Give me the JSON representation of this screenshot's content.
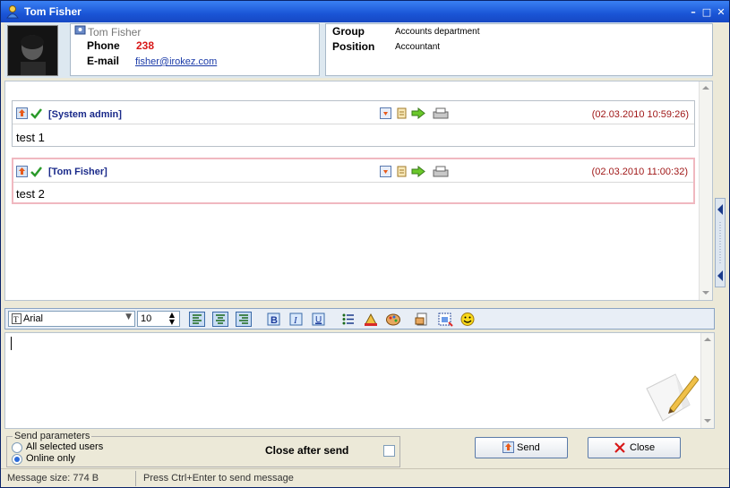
{
  "window": {
    "title": "Tom Fisher"
  },
  "contact": {
    "name": "Tom Fisher",
    "phone_label": "Phone",
    "phone": "238",
    "email_label": "E-mail",
    "email": "fisher@irokez.com",
    "group_label": "Group",
    "group": "Accounts department",
    "position_label": "Position",
    "position": "Accountant"
  },
  "messages": [
    {
      "sender": "[System admin]",
      "time": "(02.03.2010 10:59:26)",
      "text": "test 1"
    },
    {
      "sender": "[Tom Fisher]",
      "time": "(02.03.2010 11:00:32)",
      "text": "test 2"
    }
  ],
  "toolbar": {
    "font": "Arial",
    "size": "10"
  },
  "send_params": {
    "legend": "Send parameters",
    "option_all": "All selected users",
    "option_online": "Online only",
    "selected": "Online only",
    "close_after_send": "Close after send"
  },
  "buttons": {
    "send": "Send",
    "close": "Close"
  },
  "status": {
    "size": "Message size: 774 B",
    "hint": "Press Ctrl+Enter to send message"
  },
  "colors": {
    "title_bar": "#1a55d6",
    "phone": "#d81818",
    "sender": "#1a2a8a",
    "timestamp": "#a01818",
    "selected_border": "#f0b8c0"
  }
}
